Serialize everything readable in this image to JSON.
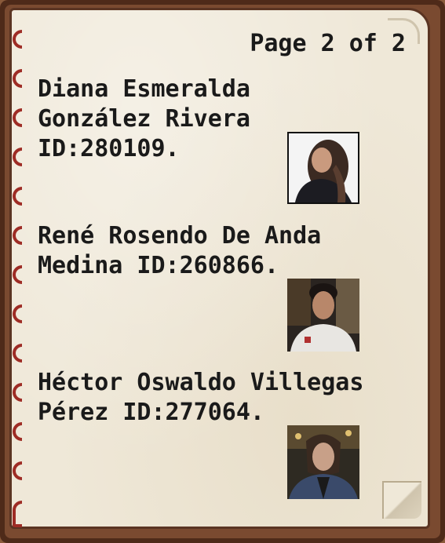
{
  "book": {
    "page_label": "Page 2 of 2"
  },
  "entries": [
    {
      "line1": "Diana Esmeralda",
      "line2": "González Rivera",
      "line3": "ID:280109.",
      "photo_icon": "portrait-photo-icon"
    },
    {
      "line1": "René Rosendo De Anda",
      "line2": "Medina ID:260866.",
      "photo_icon": "portrait-photo-icon"
    },
    {
      "line1": "Héctor Oswaldo Villegas",
      "line2": "Pérez ID:277064.",
      "photo_icon": "portrait-photo-icon"
    }
  ],
  "colors": {
    "page": "#efe8d8",
    "cover": "#4e2a19",
    "ring": "#9e2c25",
    "text": "#1a1a1a"
  }
}
